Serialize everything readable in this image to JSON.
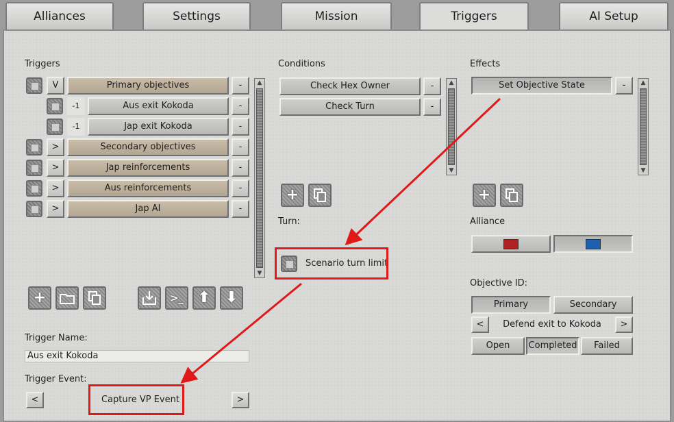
{
  "tabs": [
    {
      "label": "Alliances"
    },
    {
      "label": "Settings"
    },
    {
      "label": "Mission"
    },
    {
      "label": "Triggers",
      "active": true
    },
    {
      "label": "AI Setup"
    }
  ],
  "triggers": {
    "heading": "Triggers",
    "rows": [
      {
        "toggle": "V",
        "label": "Primary objectives",
        "style": "tan",
        "indent": false,
        "minus": "-"
      },
      {
        "toggle": "-1",
        "label": "Aus exit Kokoda",
        "style": "grey",
        "indent": true,
        "minus": "-"
      },
      {
        "toggle": "-1",
        "label": "Jap exit Kokoda",
        "style": "grey",
        "indent": true,
        "minus": "-"
      },
      {
        "toggle": ">",
        "label": "Secondary objectives",
        "style": "tan",
        "indent": false,
        "minus": "-"
      },
      {
        "toggle": ">",
        "label": "Jap reinforcements",
        "style": "tan",
        "indent": false,
        "minus": "-"
      },
      {
        "toggle": ">",
        "label": "Aus reinforcements",
        "style": "tan",
        "indent": false,
        "minus": "-"
      },
      {
        "toggle": ">",
        "label": "Jap AI",
        "style": "tan",
        "indent": false,
        "minus": "-"
      }
    ],
    "name_label": "Trigger Name:",
    "name_value": "Aus exit Kokoda",
    "event_label": "Trigger Event:",
    "event_value": "Capture VP Event",
    "event_prev": "<",
    "event_next": ">"
  },
  "conditions": {
    "heading": "Conditions",
    "items": [
      {
        "label": "Check Hex Owner",
        "minus": "-"
      },
      {
        "label": "Check Turn",
        "minus": "-"
      }
    ],
    "turn_label": "Turn:",
    "turn_limit_label": "Scenario turn limit"
  },
  "effects": {
    "heading": "Effects",
    "items": [
      {
        "label": "Set Objective State",
        "minus": "-"
      }
    ],
    "alliance_label": "Alliance",
    "alliance_colors": [
      "#b02020",
      "#1f5fb0"
    ],
    "objective_label": "Objective ID:",
    "objective_types": [
      "Primary",
      "Secondary"
    ],
    "objective_name": "Defend exit to Kokoda",
    "objective_prev": "<",
    "objective_next": ">",
    "states": [
      "Open",
      "Completed",
      "Failed"
    ]
  },
  "colors": {
    "highlight": "#e01818"
  }
}
